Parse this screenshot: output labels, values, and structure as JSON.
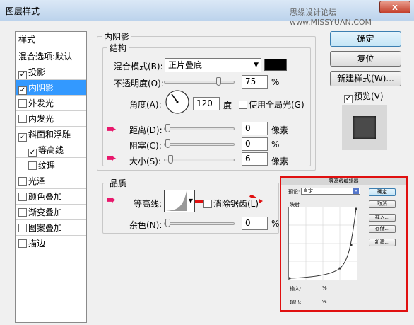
{
  "window": {
    "title": "图层样式",
    "watermark": "思缘设计论坛 www.MISSYUAN.COM",
    "close_label": "x"
  },
  "styles": {
    "header": "样式",
    "blend_default": "混合选项:默认",
    "items": [
      {
        "label": "投影",
        "checked": true
      },
      {
        "label": "内阴影",
        "checked": true
      },
      {
        "label": "外发光",
        "checked": false
      },
      {
        "label": "内发光",
        "checked": false
      },
      {
        "label": "斜面和浮雕",
        "checked": true
      },
      {
        "label": "等高线",
        "checked": true
      },
      {
        "label": "纹理",
        "checked": false
      },
      {
        "label": "光泽",
        "checked": false
      },
      {
        "label": "颜色叠加",
        "checked": false
      },
      {
        "label": "渐变叠加",
        "checked": false
      },
      {
        "label": "图案叠加",
        "checked": false
      },
      {
        "label": "描边",
        "checked": false
      }
    ]
  },
  "inner_shadow": {
    "title": "内阴影",
    "structure_title": "结构",
    "blend_mode_label": "混合模式(B):",
    "blend_mode_value": "正片叠底",
    "blend_color": "#000000",
    "opacity_label": "不透明度(O):",
    "opacity_value": "75",
    "opacity_unit": "%",
    "opacity": 75,
    "angle_label": "角度(A):",
    "angle_value": "120",
    "angle_unit": "度",
    "global_light_label": "使用全局光(G)",
    "global_light_checked": true,
    "distance_label": "距离(D):",
    "distance_value": "0",
    "distance_unit": "像素",
    "choke_label": "阻塞(C):",
    "choke_value": "0",
    "choke_unit": "%",
    "size_label": "大小(S):",
    "size_value": "6",
    "size_unit": "像素"
  },
  "quality": {
    "title": "品质",
    "contour_label": "等高线:",
    "antialias_label": "消除锯齿(L)",
    "antialias_checked": false,
    "noise_label": "杂色(N):",
    "noise_value": "0",
    "noise_unit": "%"
  },
  "buttons": {
    "ok": "确定",
    "reset": "复位",
    "new_style": "新建样式(W)...",
    "preview_label": "预览(V)",
    "preview_checked": true
  },
  "contour_editor": {
    "title": "等高线编辑器",
    "preset_label": "预设:",
    "preset_value": "自定",
    "mapping_label": "映射",
    "input_label": "输入:",
    "input_unit": "%",
    "output_label": "输出:",
    "output_unit": "%",
    "ok": "确定",
    "cancel": "取消",
    "load": "载入...",
    "save": "存储...",
    "new": "新建..."
  },
  "colors": {
    "accent": "#e8186c",
    "highlight": "#e01010",
    "selection": "#3399ff"
  }
}
